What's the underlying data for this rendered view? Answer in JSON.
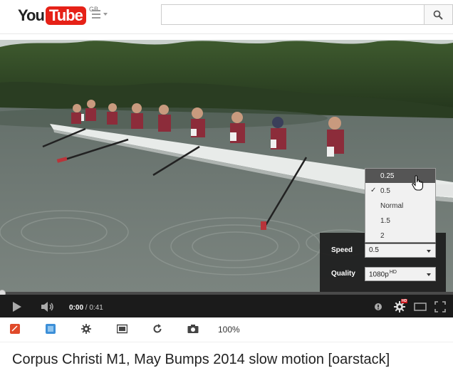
{
  "header": {
    "logo_you": "You",
    "logo_tube": "Tube",
    "region": "GB",
    "search_placeholder": ""
  },
  "player": {
    "current_time": "0:00",
    "duration": "/ 0:41",
    "progress_fraction": 0.0,
    "settings": {
      "speed_label": "Speed",
      "speed_value": "0.5",
      "quality_label": "Quality",
      "quality_value": "1080p",
      "quality_badge": "HD",
      "hd_icon_badge": "HD"
    },
    "speed_options": [
      {
        "label": "0.25",
        "highlighted": true,
        "checked": false
      },
      {
        "label": "0.5",
        "highlighted": false,
        "checked": true
      },
      {
        "label": "Normal",
        "highlighted": false,
        "checked": false
      },
      {
        "label": "1.5",
        "highlighted": false,
        "checked": false
      },
      {
        "label": "2",
        "highlighted": false,
        "checked": false
      }
    ],
    "check_mark": "✓"
  },
  "toolbar": {
    "zoom": "100%"
  },
  "video_title": "Corpus Christi M1, May Bumps 2014 slow motion [oarstack]",
  "colors": {
    "brand_red": "#e62117",
    "control_bg": "#1b1b1b",
    "menu_highlight": "#555555"
  }
}
